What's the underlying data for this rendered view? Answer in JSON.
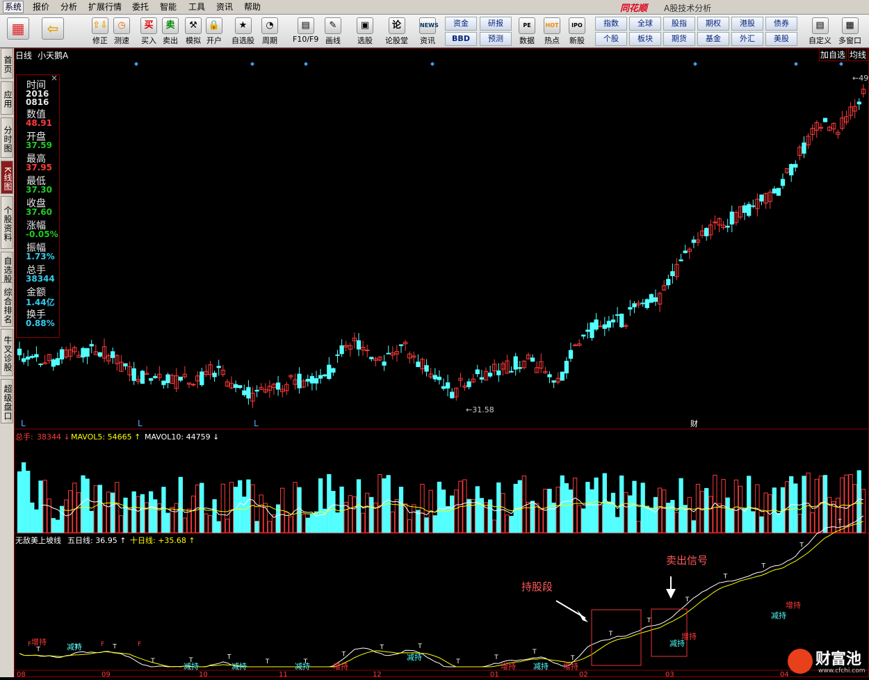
{
  "menu": {
    "items": [
      "系统",
      "报价",
      "分析",
      "扩展行情",
      "委托",
      "智能",
      "工具",
      "资讯",
      "帮助"
    ],
    "active": "系统"
  },
  "app": {
    "brand": "同花顺",
    "title": "A股技术分析"
  },
  "toolbar": {
    "buttons": [
      {
        "label": "",
        "icon": "grid-icon"
      },
      {
        "label": "",
        "icon": "back-arrow-icon"
      },
      {
        "label": "修正",
        "icon": "up-down-icon"
      },
      {
        "label": "测速",
        "icon": "clock-icon"
      },
      {
        "label": "买入",
        "icon": "buy-icon"
      },
      {
        "label": "卖出",
        "icon": "sell-icon"
      },
      {
        "label": "模拟",
        "icon": "hammer-icon"
      },
      {
        "label": "开户",
        "icon": "lock-icon"
      },
      {
        "label": "自选股",
        "icon": "star-icon"
      },
      {
        "label": "周期",
        "icon": "cycle-icon"
      },
      {
        "label": "F10/F9",
        "icon": "f10-icon"
      },
      {
        "label": "画线",
        "icon": "pencil-icon"
      },
      {
        "label": "选股",
        "icon": "monitor-icon"
      },
      {
        "label": "论股堂",
        "icon": "lun-icon"
      },
      {
        "label": "资讯",
        "icon": "news-icon"
      },
      {
        "label": "数据",
        "icon": "data-icon"
      },
      {
        "label": "热点",
        "icon": "hot-icon"
      },
      {
        "label": "新股",
        "icon": "new-stock-icon"
      },
      {
        "label": "自定义",
        "icon": "custom-icon"
      },
      {
        "label": "多窗口",
        "icon": "multi-window-icon"
      }
    ],
    "icon_text": {
      "buy": "买",
      "sell": "卖",
      "news": "NEWS",
      "lun": "论",
      "back": "⇦",
      "updown": "⇧⇩",
      "clock": "◷",
      "star": "★",
      "cycle": "◔",
      "pencil": "✎",
      "monitor": "▣",
      "data": "PE",
      "hot": "HOT",
      "newstock": "IPO",
      "custom": "▤",
      "multi": "▦",
      "lock": "🔒",
      "hammer": "⚒",
      "f10": "▤"
    },
    "grid_left": [
      "资金",
      "研报",
      "BBD",
      "预测"
    ],
    "grid_right": [
      "指数",
      "全球",
      "股指",
      "期权",
      "港股",
      "债券",
      "个股",
      "板块",
      "期货",
      "基金",
      "外汇",
      "美股"
    ]
  },
  "sidebar": {
    "tabs": [
      "首页",
      "应用",
      "分时图",
      "K线图",
      "个股资料",
      "自选股",
      "综合排名",
      "牛叉诊股",
      "超级盘口"
    ],
    "active": "K线图"
  },
  "chart_header": {
    "period": "日线",
    "stock": "小天鹅A",
    "add_watch": "加自选",
    "ma_button": "均线"
  },
  "info_panel": {
    "close": "×",
    "rows": [
      {
        "label": "时间",
        "value": "2016",
        "value2": "0816",
        "color": "#e6e6e6"
      },
      {
        "label": "数值",
        "value": "48.91",
        "color": "#ff3b3b"
      },
      {
        "label": "开盘",
        "value": "37.59",
        "color": "#22cc22"
      },
      {
        "label": "最高",
        "value": "37.95",
        "color": "#ff3b3b"
      },
      {
        "label": "最低",
        "value": "37.30",
        "color": "#22cc22"
      },
      {
        "label": "收盘",
        "value": "37.60",
        "color": "#22cc22"
      },
      {
        "label": "涨幅",
        "value": "-0.05%",
        "color": "#22cc22"
      },
      {
        "label": "振幅",
        "value": "1.73%",
        "color": "#33ccee"
      },
      {
        "label": "总手",
        "value": "38344",
        "color": "#33ccee"
      },
      {
        "label": "金额",
        "value": "1.44亿",
        "color": "#33ccee"
      },
      {
        "label": "换手",
        "value": "0.88%",
        "color": "#33ccee"
      }
    ]
  },
  "price_chart": {
    "high_label": "49",
    "low_label": "31.58",
    "markers_L": [
      "L",
      "L",
      "L"
    ],
    "marker_cai": "财"
  },
  "volume_header": {
    "total_label": "总手:",
    "total_value": "38344",
    "mavol5_label": "MAVOL5:",
    "mavol5_value": "54665",
    "mavol10_label": "MAVOL10:",
    "mavol10_value": "44759"
  },
  "indicator_header": {
    "name": "无敌美上坡线",
    "ma5_label": "五日线:",
    "ma5_value": "36.95",
    "ma10_label": "十日线:",
    "ma10_value": "+35.68"
  },
  "annotations": {
    "hold": "持股段",
    "sell": "卖出信号"
  },
  "indicator_labels": {
    "reduce": "减持",
    "add": "增持",
    "t": "T",
    "f": "F"
  },
  "date_ticks": [
    "08",
    "09",
    "10",
    "11",
    "12",
    "01",
    "02",
    "03",
    "04"
  ],
  "watermark": {
    "brand": "财富池",
    "url": "www.cfchi.com"
  },
  "colors": {
    "up": "#ff3b3b",
    "down": "#54ffff",
    "ma5": "#ffffff",
    "ma10": "#ffff00",
    "frame": "#8b0000"
  },
  "chart_data": {
    "type": "candlestick",
    "stock": "小天鹅A",
    "period": "日线",
    "price_range": [
      31.58,
      49
    ],
    "high": 49,
    "low": 31.58
  }
}
